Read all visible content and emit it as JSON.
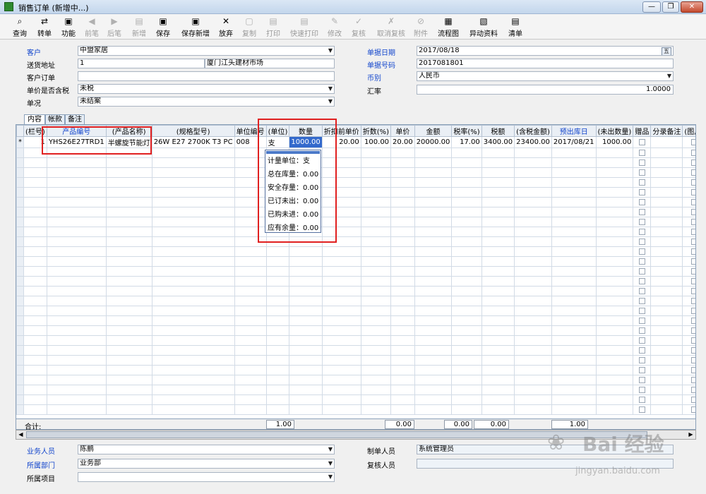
{
  "window": {
    "title": "销售订单 (新增中...)",
    "minimize": "—",
    "restore": "❐",
    "close": "✕"
  },
  "toolbar": [
    {
      "label": "查询",
      "icon": "⌕",
      "enabled": true
    },
    {
      "label": "转单",
      "icon": "⇄",
      "enabled": true
    },
    {
      "label": "功能",
      "icon": "▣",
      "enabled": true
    },
    {
      "label": "前笔",
      "icon": "◀",
      "enabled": false
    },
    {
      "label": "后笔",
      "icon": "▶",
      "enabled": false
    },
    {
      "label": "新增",
      "icon": "▤",
      "enabled": false
    },
    {
      "label": "保存",
      "icon": "▣",
      "enabled": true
    },
    {
      "label": "保存新增",
      "icon": "▣",
      "enabled": true
    },
    {
      "label": "放弃",
      "icon": "✕",
      "enabled": true
    },
    {
      "label": "复制",
      "icon": "▢",
      "enabled": false
    },
    {
      "label": "打印",
      "icon": "▤",
      "enabled": false
    },
    {
      "label": "快速打印",
      "icon": "▤",
      "enabled": false
    },
    {
      "label": "修改",
      "icon": "✎",
      "enabled": false
    },
    {
      "label": "复核",
      "icon": "✓",
      "enabled": false
    },
    {
      "label": "取消复核",
      "icon": "✗",
      "enabled": false
    },
    {
      "label": "附件",
      "icon": "⊘",
      "enabled": false
    },
    {
      "label": "流程图",
      "icon": "▦",
      "enabled": true
    },
    {
      "label": "异动资料",
      "icon": "▧",
      "enabled": true
    },
    {
      "label": "清单",
      "icon": "▤",
      "enabled": true
    }
  ],
  "header": {
    "customer_label": "客户",
    "customer_value": "中盟家居",
    "address_label": "送货地址",
    "address_code": "1",
    "address_value": "厦门江头建材市场",
    "custorder_label": "客户订单",
    "custorder_value": "",
    "taxincl_label": "单价是否含税",
    "taxincl_value": "未税",
    "status_label": "单况",
    "status_value": "未结案",
    "date_label": "单据日期",
    "date_value": "2017/08/18",
    "date_btn": "五",
    "docno_label": "单据号码",
    "docno_value": "2017081801",
    "currency_label": "币别",
    "currency_value": "人民币",
    "rate_label": "汇率",
    "rate_value": "1.0000"
  },
  "tabs": [
    "内容",
    "帐款",
    "备注"
  ],
  "grid": {
    "columns": [
      "(栏号)",
      "产品编号",
      "(产品名称)",
      "(规格型号)",
      "单位编号",
      "(单位)",
      "数量",
      "折扣前单价",
      "折数(%)",
      "单价",
      "金额",
      "税率(%)",
      "税额",
      "(含税金额)",
      "预出库日",
      "(未出数量)",
      "赠品",
      "分录备注",
      "(图片)",
      "(来源单别"
    ],
    "blue_columns": [
      "产品编号",
      "预出库日"
    ],
    "row": [
      "1",
      "YHS26E27TRD1",
      "半螺旋节能灯",
      "26W E27 2700K T3 PC",
      "008",
      "支",
      "1000.00",
      "20.00",
      "100.00",
      "20.00",
      "20000.00",
      "17.00",
      "3400.00",
      "23400.00",
      "2017/08/21",
      "1000.00",
      "",
      "",
      "",
      ""
    ],
    "row_marker": "*"
  },
  "totals": {
    "label": "合计:",
    "qty": "1.00",
    "amount": "0.00",
    "tax": "0.00",
    "taxincl": "0.00",
    "unshipped": "1.00"
  },
  "popup": {
    "lines": [
      "计量单位：支",
      "总在库量：0.00",
      "安全存量：0.00",
      "已订未出：0.00",
      "已购未进：0.00",
      "应有余量：0.00"
    ]
  },
  "footer": {
    "sales_label": "业务人员",
    "sales_value": "陈鹏",
    "dept_label": "所属部门",
    "dept_value": "业务部",
    "project_label": "所属项目",
    "project_value": "",
    "maker_label": "制单人员",
    "maker_value": "系统管理员",
    "reviewer_label": "复核人员",
    "reviewer_value": ""
  },
  "watermark": {
    "logo": "Bai 经验",
    "url": "jingyan.baidu.com"
  }
}
